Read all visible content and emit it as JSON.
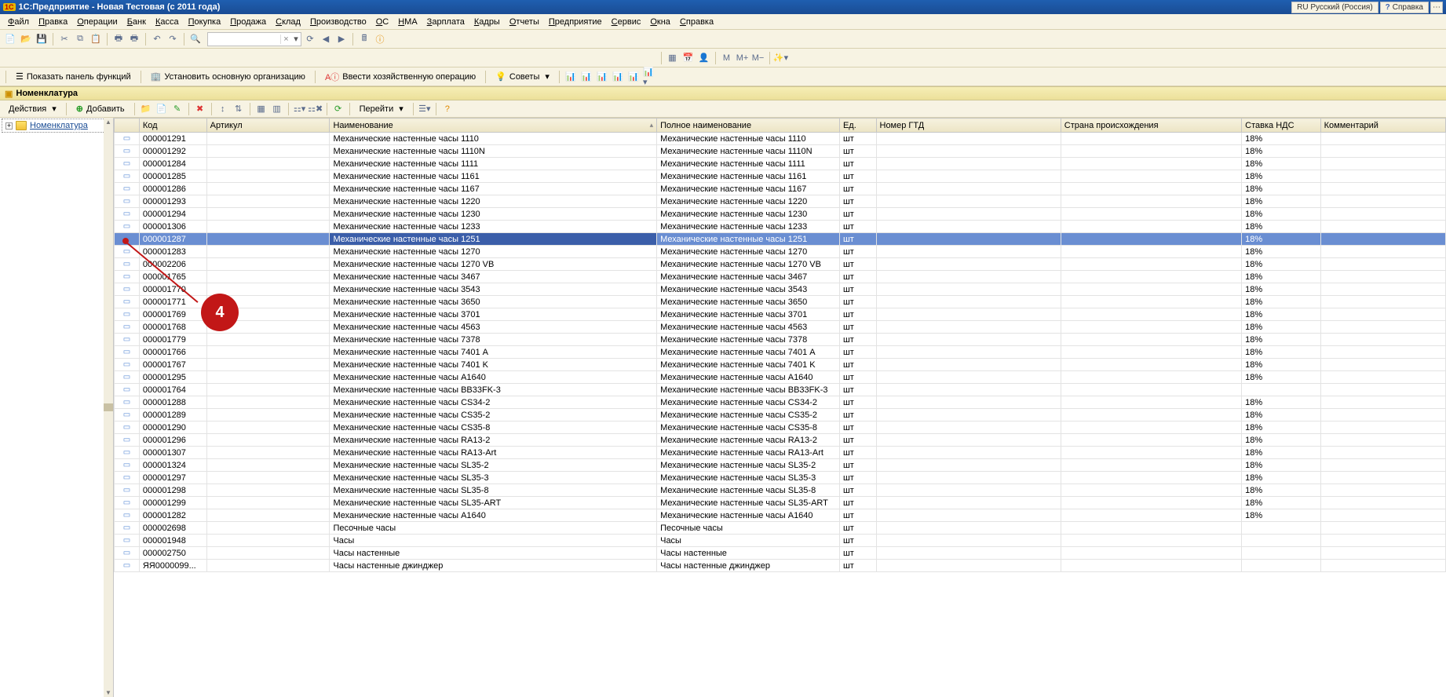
{
  "title": "1С:Предприятие - Новая Тестовая (с 2011 года)",
  "langBtn": "RU Русский (Россия)",
  "helpBtn": "Справка",
  "menu": [
    "Файл",
    "Правка",
    "Операции",
    "Банк",
    "Касса",
    "Покупка",
    "Продажа",
    "Склад",
    "Производство",
    "ОС",
    "НМА",
    "Зарплата",
    "Кадры",
    "Отчеты",
    "Предприятие",
    "Сервис",
    "Окна",
    "Справка"
  ],
  "toolbar3": {
    "showPanel": "Показать панель функций",
    "setOrg": "Установить основную организацию",
    "enterOp": "Ввести хозяйственную операцию",
    "tips": "Советы"
  },
  "tabTitle": "Номенклатура",
  "actions": {
    "label": "Действия",
    "add": "Добавить",
    "goto": "Перейти"
  },
  "tree": {
    "root": "Номенклатура"
  },
  "columns": {
    "code": "Код",
    "art": "Артикул",
    "name": "Наименование",
    "full": "Полное наименование",
    "unit": "Ед.",
    "gtd": "Номер ГТД",
    "country": "Страна происхождения",
    "vat": "Ставка НДС",
    "comment": "Комментарий"
  },
  "annotation": "4",
  "rows": [
    {
      "code": "000001291",
      "name": "Механические настенные часы 1110",
      "full": "Механические настенные часы 1110",
      "unit": "шт",
      "vat": "18%"
    },
    {
      "code": "000001292",
      "name": "Механические настенные часы 1110N",
      "full": "Механические настенные часы 1110N",
      "unit": "шт",
      "vat": "18%"
    },
    {
      "code": "000001284",
      "name": "Механические настенные часы 1111",
      "full": "Механические настенные часы 1111",
      "unit": "шт",
      "vat": "18%"
    },
    {
      "code": "000001285",
      "name": "Механические настенные часы 1161",
      "full": "Механические настенные часы 1161",
      "unit": "шт",
      "vat": "18%"
    },
    {
      "code": "000001286",
      "name": "Механические настенные часы 1167",
      "full": "Механические настенные часы 1167",
      "unit": "шт",
      "vat": "18%"
    },
    {
      "code": "000001293",
      "name": "Механические настенные часы 1220",
      "full": "Механические настенные часы 1220",
      "unit": "шт",
      "vat": "18%"
    },
    {
      "code": "000001294",
      "name": "Механические настенные часы 1230",
      "full": "Механические настенные часы 1230",
      "unit": "шт",
      "vat": "18%"
    },
    {
      "code": "000001306",
      "name": "Механические настенные часы 1233",
      "full": "Механические настенные часы 1233",
      "unit": "шт",
      "vat": "18%"
    },
    {
      "code": "000001287",
      "name": "Механические настенные часы 1251",
      "full": "Механические настенные часы 1251",
      "unit": "шт",
      "vat": "18%",
      "sel": true
    },
    {
      "code": "000001283",
      "name": "Механические настенные часы 1270",
      "full": "Механические настенные часы 1270",
      "unit": "шт",
      "vat": "18%"
    },
    {
      "code": "000002206",
      "name": "Механические настенные часы 1270 VB",
      "full": "Механические настенные часы 1270 VB",
      "unit": "шт",
      "vat": "18%"
    },
    {
      "code": "000001765",
      "name": "Механические настенные часы 3467",
      "full": "Механические настенные часы 3467",
      "unit": "шт",
      "vat": "18%"
    },
    {
      "code": "000001770",
      "name": "Механические настенные часы 3543",
      "full": "Механические настенные часы 3543",
      "unit": "шт",
      "vat": "18%"
    },
    {
      "code": "000001771",
      "name": "Механические настенные часы 3650",
      "full": "Механические настенные часы 3650",
      "unit": "шт",
      "vat": "18%"
    },
    {
      "code": "000001769",
      "name": "Механические настенные часы 3701",
      "full": "Механические настенные часы 3701",
      "unit": "шт",
      "vat": "18%"
    },
    {
      "code": "000001768",
      "name": "Механические настенные часы 4563",
      "full": "Механические настенные часы 4563",
      "unit": "шт",
      "vat": "18%"
    },
    {
      "code": "000001779",
      "name": "Механические настенные часы 7378",
      "full": "Механические настенные часы 7378",
      "unit": "шт",
      "vat": "18%"
    },
    {
      "code": "000001766",
      "name": "Механические настенные часы 7401 A",
      "full": "Механические настенные часы 7401 A",
      "unit": "шт",
      "vat": "18%"
    },
    {
      "code": "000001767",
      "name": "Механические настенные часы 7401 K",
      "full": "Механические настенные часы 7401 K",
      "unit": "шт",
      "vat": "18%"
    },
    {
      "code": "000001295",
      "name": "Механические настенные часы A1640",
      "full": "Механические настенные часы A1640",
      "unit": "шт",
      "vat": "18%"
    },
    {
      "code": "000001764",
      "name": "Механические настенные часы BB33FK-3",
      "full": "Механические настенные часы BB33FK-3",
      "unit": "шт",
      "vat": ""
    },
    {
      "code": "000001288",
      "name": "Механические настенные часы CS34-2",
      "full": "Механические настенные часы CS34-2",
      "unit": "шт",
      "vat": "18%"
    },
    {
      "code": "000001289",
      "name": "Механические настенные часы CS35-2",
      "full": "Механические настенные часы CS35-2",
      "unit": "шт",
      "vat": "18%"
    },
    {
      "code": "000001290",
      "name": "Механические настенные часы CS35-8",
      "full": "Механические настенные часы CS35-8",
      "unit": "шт",
      "vat": "18%"
    },
    {
      "code": "000001296",
      "name": "Механические настенные часы RA13-2",
      "full": "Механические настенные часы RA13-2",
      "unit": "шт",
      "vat": "18%"
    },
    {
      "code": "000001307",
      "name": "Механические настенные часы RA13-Art",
      "full": "Механические настенные часы RA13-Art",
      "unit": "шт",
      "vat": "18%"
    },
    {
      "code": "000001324",
      "name": "Механические настенные часы SL35-2",
      "full": "Механические настенные часы SL35-2",
      "unit": "шт",
      "vat": "18%"
    },
    {
      "code": "000001297",
      "name": "Механические настенные часы SL35-3",
      "full": "Механические настенные часы SL35-3",
      "unit": "шт",
      "vat": "18%"
    },
    {
      "code": "000001298",
      "name": "Механические настенные часы SL35-8",
      "full": "Механические настенные часы SL35-8",
      "unit": "шт",
      "vat": "18%"
    },
    {
      "code": "000001299",
      "name": "Механические настенные часы SL35-ART",
      "full": "Механические настенные часы SL35-ART",
      "unit": "шт",
      "vat": "18%"
    },
    {
      "code": "000001282",
      "name": "Механические настенные часы А1640",
      "full": "Механические настенные часы А1640",
      "unit": "шт",
      "vat": "18%"
    },
    {
      "code": "000002698",
      "name": "Песочные часы",
      "full": "Песочные часы",
      "unit": "шт",
      "vat": ""
    },
    {
      "code": "000001948",
      "name": "Часы",
      "full": "Часы",
      "unit": "шт",
      "vat": ""
    },
    {
      "code": "000002750",
      "name": "Часы настенные",
      "full": "Часы настенные",
      "unit": "шт",
      "vat": ""
    },
    {
      "code": "ЯЯ0000099...",
      "name": "Часы настенные джинджер",
      "full": "Часы настенные джинджер",
      "unit": "шт",
      "vat": ""
    }
  ]
}
